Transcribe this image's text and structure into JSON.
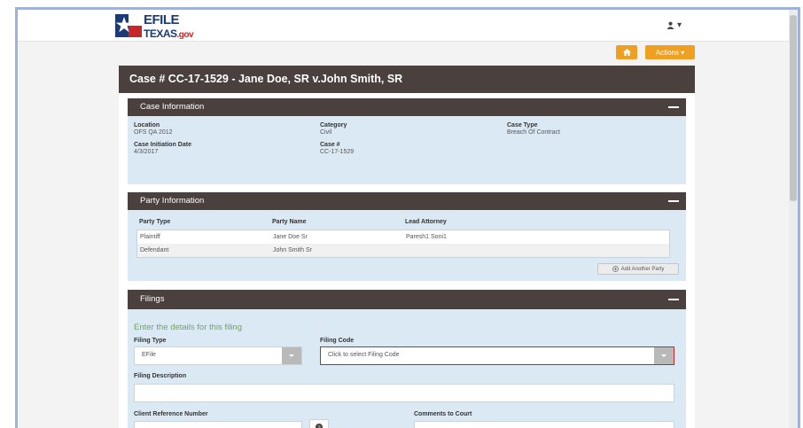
{
  "header": {
    "logo_efile": "EFILE",
    "logo_texas": "TEXAS",
    "logo_gov": ".gov",
    "user_icon": "user-icon"
  },
  "toolbar": {
    "home_icon": "home-icon",
    "actions_label": "Actions ▾"
  },
  "case": {
    "title": "Case # CC-17-1529 - Jane Doe, SR v.John Smith, SR"
  },
  "case_info": {
    "section_title": "Case Information",
    "location_label": "Location",
    "location_value": "OFS QA 2012",
    "category_label": "Category",
    "category_value": "Civil",
    "case_type_label": "Case Type",
    "case_type_value": "Breach Of Contract",
    "initiation_label": "Case Initiation Date",
    "initiation_value": "4/3/2017",
    "case_num_label": "Case #",
    "case_num_value": "CC-17-1529"
  },
  "party_info": {
    "section_title": "Party Information",
    "columns": [
      "Party Type",
      "Party Name",
      "Lead Attorney"
    ],
    "rows": [
      [
        "Plaintiff",
        "Jane Doe Sr",
        "Paresh1 Soni1"
      ],
      [
        "Defendant",
        "John Smith Sr",
        ""
      ]
    ],
    "add_party_label": "Add Another Party"
  },
  "filings": {
    "section_title": "Filings",
    "subtitle": "Enter the details for this filing",
    "filing_type_label": "Filing Type",
    "filing_type_value": "EFile",
    "filing_code_label": "Filing Code",
    "filing_code_placeholder": "Click to select Filing Code",
    "filing_desc_label": "Filing Description",
    "client_ref_label": "Client Reference Number",
    "comments_label": "Comments to Court"
  },
  "colors": {
    "brand_dark": "#4a403e",
    "accent_orange": "#f0a020",
    "panel_blue": "#dbe9f5",
    "error_red": "#c62828"
  }
}
